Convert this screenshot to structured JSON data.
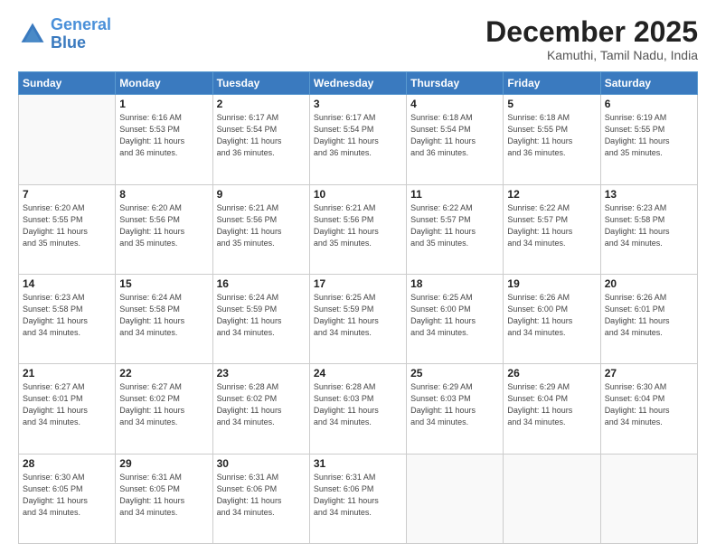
{
  "logo": {
    "line1": "General",
    "line2": "Blue"
  },
  "title": "December 2025",
  "subtitle": "Kamuthi, Tamil Nadu, India",
  "days_header": [
    "Sunday",
    "Monday",
    "Tuesday",
    "Wednesday",
    "Thursday",
    "Friday",
    "Saturday"
  ],
  "weeks": [
    [
      {
        "num": "",
        "info": ""
      },
      {
        "num": "1",
        "info": "Sunrise: 6:16 AM\nSunset: 5:53 PM\nDaylight: 11 hours\nand 36 minutes."
      },
      {
        "num": "2",
        "info": "Sunrise: 6:17 AM\nSunset: 5:54 PM\nDaylight: 11 hours\nand 36 minutes."
      },
      {
        "num": "3",
        "info": "Sunrise: 6:17 AM\nSunset: 5:54 PM\nDaylight: 11 hours\nand 36 minutes."
      },
      {
        "num": "4",
        "info": "Sunrise: 6:18 AM\nSunset: 5:54 PM\nDaylight: 11 hours\nand 36 minutes."
      },
      {
        "num": "5",
        "info": "Sunrise: 6:18 AM\nSunset: 5:55 PM\nDaylight: 11 hours\nand 36 minutes."
      },
      {
        "num": "6",
        "info": "Sunrise: 6:19 AM\nSunset: 5:55 PM\nDaylight: 11 hours\nand 35 minutes."
      }
    ],
    [
      {
        "num": "7",
        "info": "Sunrise: 6:20 AM\nSunset: 5:55 PM\nDaylight: 11 hours\nand 35 minutes."
      },
      {
        "num": "8",
        "info": "Sunrise: 6:20 AM\nSunset: 5:56 PM\nDaylight: 11 hours\nand 35 minutes."
      },
      {
        "num": "9",
        "info": "Sunrise: 6:21 AM\nSunset: 5:56 PM\nDaylight: 11 hours\nand 35 minutes."
      },
      {
        "num": "10",
        "info": "Sunrise: 6:21 AM\nSunset: 5:56 PM\nDaylight: 11 hours\nand 35 minutes."
      },
      {
        "num": "11",
        "info": "Sunrise: 6:22 AM\nSunset: 5:57 PM\nDaylight: 11 hours\nand 35 minutes."
      },
      {
        "num": "12",
        "info": "Sunrise: 6:22 AM\nSunset: 5:57 PM\nDaylight: 11 hours\nand 34 minutes."
      },
      {
        "num": "13",
        "info": "Sunrise: 6:23 AM\nSunset: 5:58 PM\nDaylight: 11 hours\nand 34 minutes."
      }
    ],
    [
      {
        "num": "14",
        "info": "Sunrise: 6:23 AM\nSunset: 5:58 PM\nDaylight: 11 hours\nand 34 minutes."
      },
      {
        "num": "15",
        "info": "Sunrise: 6:24 AM\nSunset: 5:58 PM\nDaylight: 11 hours\nand 34 minutes."
      },
      {
        "num": "16",
        "info": "Sunrise: 6:24 AM\nSunset: 5:59 PM\nDaylight: 11 hours\nand 34 minutes."
      },
      {
        "num": "17",
        "info": "Sunrise: 6:25 AM\nSunset: 5:59 PM\nDaylight: 11 hours\nand 34 minutes."
      },
      {
        "num": "18",
        "info": "Sunrise: 6:25 AM\nSunset: 6:00 PM\nDaylight: 11 hours\nand 34 minutes."
      },
      {
        "num": "19",
        "info": "Sunrise: 6:26 AM\nSunset: 6:00 PM\nDaylight: 11 hours\nand 34 minutes."
      },
      {
        "num": "20",
        "info": "Sunrise: 6:26 AM\nSunset: 6:01 PM\nDaylight: 11 hours\nand 34 minutes."
      }
    ],
    [
      {
        "num": "21",
        "info": "Sunrise: 6:27 AM\nSunset: 6:01 PM\nDaylight: 11 hours\nand 34 minutes."
      },
      {
        "num": "22",
        "info": "Sunrise: 6:27 AM\nSunset: 6:02 PM\nDaylight: 11 hours\nand 34 minutes."
      },
      {
        "num": "23",
        "info": "Sunrise: 6:28 AM\nSunset: 6:02 PM\nDaylight: 11 hours\nand 34 minutes."
      },
      {
        "num": "24",
        "info": "Sunrise: 6:28 AM\nSunset: 6:03 PM\nDaylight: 11 hours\nand 34 minutes."
      },
      {
        "num": "25",
        "info": "Sunrise: 6:29 AM\nSunset: 6:03 PM\nDaylight: 11 hours\nand 34 minutes."
      },
      {
        "num": "26",
        "info": "Sunrise: 6:29 AM\nSunset: 6:04 PM\nDaylight: 11 hours\nand 34 minutes."
      },
      {
        "num": "27",
        "info": "Sunrise: 6:30 AM\nSunset: 6:04 PM\nDaylight: 11 hours\nand 34 minutes."
      }
    ],
    [
      {
        "num": "28",
        "info": "Sunrise: 6:30 AM\nSunset: 6:05 PM\nDaylight: 11 hours\nand 34 minutes."
      },
      {
        "num": "29",
        "info": "Sunrise: 6:31 AM\nSunset: 6:05 PM\nDaylight: 11 hours\nand 34 minutes."
      },
      {
        "num": "30",
        "info": "Sunrise: 6:31 AM\nSunset: 6:06 PM\nDaylight: 11 hours\nand 34 minutes."
      },
      {
        "num": "31",
        "info": "Sunrise: 6:31 AM\nSunset: 6:06 PM\nDaylight: 11 hours\nand 34 minutes."
      },
      {
        "num": "",
        "info": ""
      },
      {
        "num": "",
        "info": ""
      },
      {
        "num": "",
        "info": ""
      }
    ]
  ]
}
